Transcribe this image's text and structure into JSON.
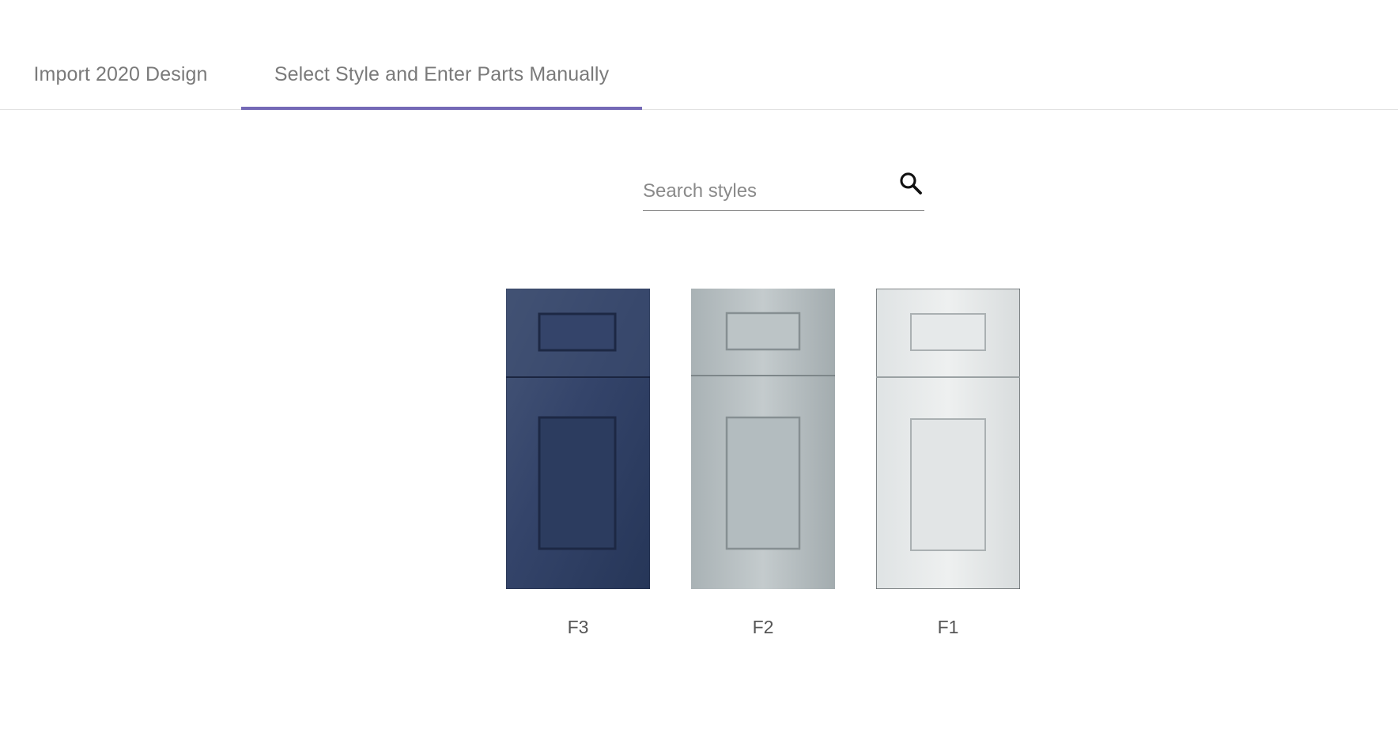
{
  "tabs": [
    {
      "label": "Import 2020 Design",
      "selected": false
    },
    {
      "label": "Select Style and Enter Parts Manually",
      "selected": true
    }
  ],
  "accent_color": "#7469b6",
  "search": {
    "placeholder": "Search styles",
    "value": "",
    "icon": "search-icon"
  },
  "styles": [
    {
      "name": "F3",
      "color": "#2d3b58"
    },
    {
      "name": "F2",
      "color": "#b3bcbf"
    },
    {
      "name": "F1",
      "color": "#e2e5e6"
    }
  ]
}
